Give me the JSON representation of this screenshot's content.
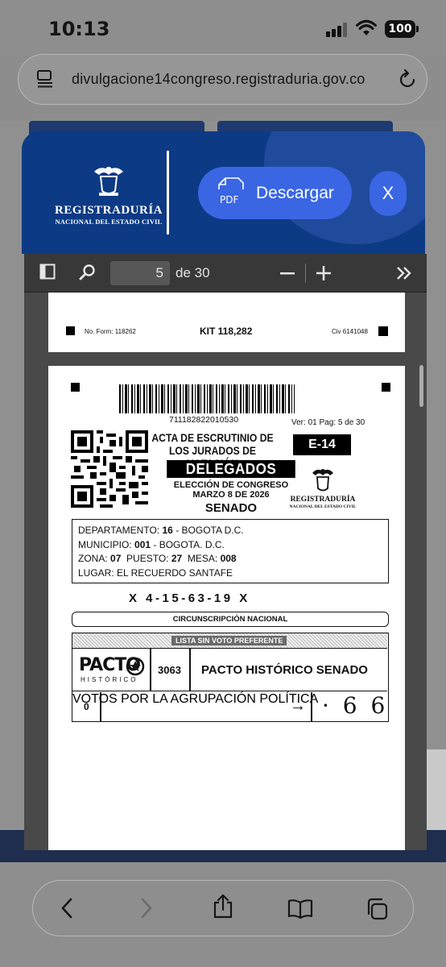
{
  "status": {
    "time": "10:13",
    "battery": "100"
  },
  "address": {
    "url": "divulgacione14congreso.registraduria.gov.co"
  },
  "header": {
    "logo_title": "REGISTRADURÍA",
    "logo_subtitle": "NACIONAL DEL ESTADO CIVIL",
    "download_label": "Descargar",
    "pdf_icon_label": "PDF",
    "close_label": "X",
    "accent_color": "#3a66e4",
    "brand_color": "#0d3a84"
  },
  "pdf_toolbar": {
    "page": "5",
    "of_label": "de 30",
    "zoom_out": "−",
    "zoom_in": "+",
    "more": "»"
  },
  "page_prev": {
    "form_no": "No. Form: 118262",
    "kit": "KIT 118,282",
    "civ": "Civ 6141048"
  },
  "document": {
    "barcode_number": "711182822010530",
    "version": "Ver: 01 Pag: 5 de 30",
    "acta_title": "ACTA DE ESCRUTINIO DE LOS JURADOS DE VOTACIÓN",
    "delegados": "DELEGADOS",
    "eleccion": "ELECCIÓN DE CONGRESO",
    "fecha": "MARZO 8 DE 2026",
    "senado": "SENADO",
    "form_code": "E-14",
    "logo_title": "REGISTRADURÍA",
    "logo_subtitle": "NACIONAL DEL ESTADO CIVIL",
    "location": {
      "dep_label": "DEPARTAMENTO:",
      "dep_code": "16",
      "dep_name": "- BOGOTA D.C.",
      "mun_label": "MUNICIPIO:",
      "mun_code": "001",
      "mun_name": "- BOGOTA. D.C.",
      "zona_label": "ZONA:",
      "zona": "07",
      "puesto_label": "PUESTO:",
      "puesto": "27",
      "mesa_label": "MESA:",
      "mesa": "008",
      "lugar_label": "LUGAR:",
      "lugar": "EL RECUERDO SANTAFE"
    },
    "code_line": "X  4-15-63-19  X",
    "circunscripcion": "CIRCUNSCRIPCIÓN NACIONAL",
    "lista_header": "LISTA SIN VOTO PREFERENTE",
    "party_logo_text": "PACTO",
    "party_logo_sub": "HISTÓRICO",
    "party_number": "3063",
    "party_name": "PACTO HISTÓRICO SENADO",
    "row_prefix": "0",
    "votes_label": "VOTOS POR LA AGRUPACIÓN POLÍTICA",
    "votes_handwritten": "· 6 6"
  }
}
